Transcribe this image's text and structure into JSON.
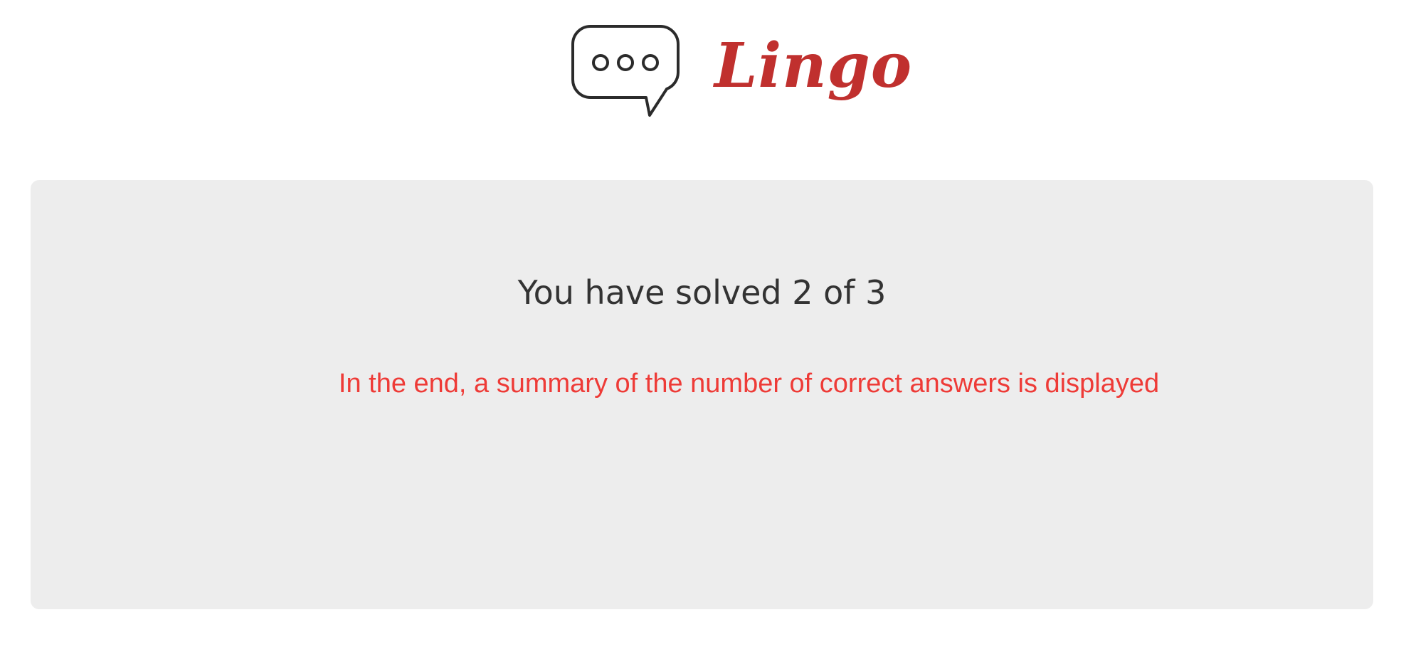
{
  "app": {
    "brand_name": "Lingo",
    "logo_icon": "speech-bubble-icon",
    "brand_color": "#c0302e"
  },
  "result": {
    "summary_text": "You have solved 2 of 3",
    "solved": 2,
    "total": 3
  },
  "annotation": {
    "text": "In the end, a summary of the number of correct answers is displayed",
    "color": "#ee3b37"
  }
}
